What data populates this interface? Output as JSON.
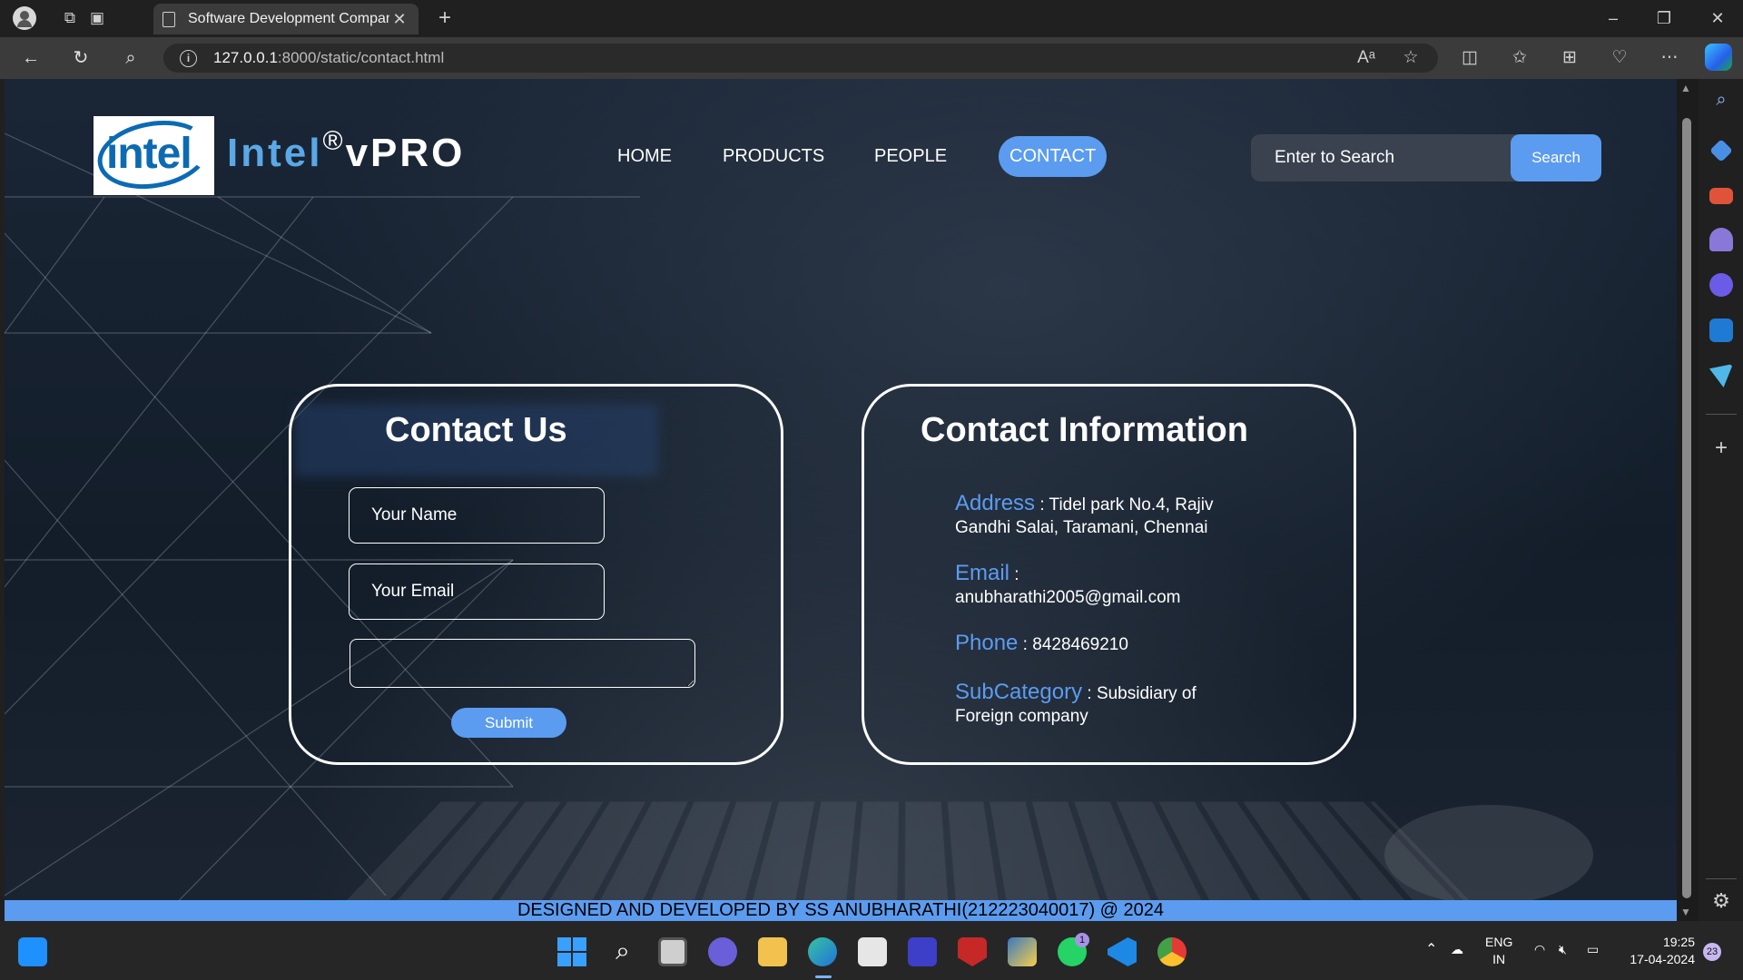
{
  "browser": {
    "tab_title": "Software Development Company",
    "url_host": "127.0.0.1",
    "url_rest": ":8000/static/contact.html"
  },
  "site": {
    "logo_text": "intel",
    "brand_intel": "Intel",
    "brand_reg": "®",
    "brand_vpro": "vPRO",
    "nav": [
      {
        "label": "HOME"
      },
      {
        "label": "PRODUCTS"
      },
      {
        "label": "PEOPLE"
      },
      {
        "label": "CONTACT"
      }
    ],
    "search_placeholder": "Enter to Search",
    "search_button": "Search"
  },
  "contact_form": {
    "title": "Contact Us",
    "name_placeholder": "Your Name",
    "email_placeholder": "Your Email",
    "submit_label": "Submit"
  },
  "contact_info": {
    "title": "Contact Information",
    "items": [
      {
        "label": "Address",
        "sep": " : ",
        "value": "Tidel park No.4, Rajiv Gandhi Salai, Taramani, Chennai"
      },
      {
        "label": "Email",
        "sep": " :",
        "value": "anubharathi2005@gmail.com"
      },
      {
        "label": "Phone",
        "sep": " : ",
        "value": "8428469210"
      },
      {
        "label": "SubCategory",
        "sep": " : ",
        "value": "Subsidiary of Foreign company"
      }
    ]
  },
  "footer": {
    "text": "DESIGNED AND DEVELOPED BY SS ANUBHARATHI(212223040017) @ 2024"
  },
  "taskbar": {
    "lang_top": "ENG",
    "lang_bottom": "IN",
    "time": "19:25",
    "date": "17-04-2024",
    "notification_count": "23",
    "whatsapp_badge": "1"
  },
  "colors": {
    "accent": "#5b9cf0",
    "intel_blue": "#0c6ab3",
    "page_bg": "#131d2a"
  }
}
